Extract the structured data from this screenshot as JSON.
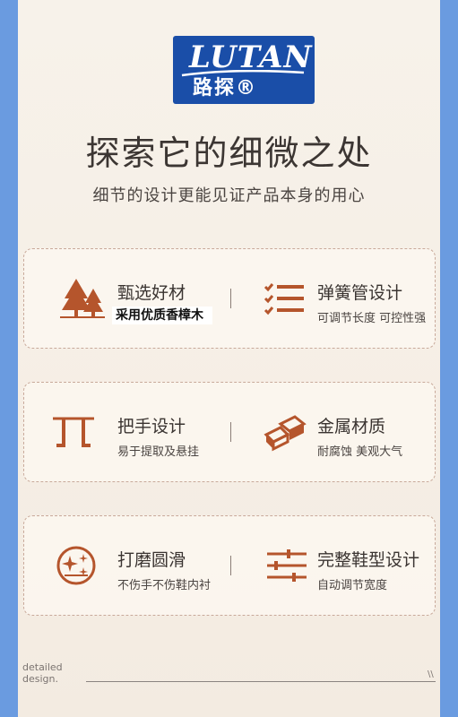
{
  "brand": {
    "logo_text": "UTAN",
    "logo_letter": "L",
    "logo_chinese": "路探®"
  },
  "header": {
    "title": "探索它的细微之处",
    "subtitle": "细节的设计更能见证产品本身的用心"
  },
  "features": [
    {
      "name": "甄选好材",
      "desc": "采用优质香樟木",
      "icon": "trees-icon"
    },
    {
      "name": "弹簧管设计",
      "desc": "可调节长度 可控性强",
      "icon": "checklist-icon"
    },
    {
      "name": "把手设计",
      "desc": "易于提取及悬挂",
      "icon": "handle-icon"
    },
    {
      "name": "金属材质",
      "desc": "耐腐蚀 美观大气",
      "icon": "metal-bars-icon"
    },
    {
      "name": "打磨圆滑",
      "desc": "不伤手不伤鞋内衬",
      "icon": "sparkle-circle-icon"
    },
    {
      "name": "完整鞋型设计",
      "desc": "自动调节宽度",
      "icon": "sliders-icon"
    }
  ],
  "footer": {
    "line1": "detailed",
    "line2": "design.",
    "mark": "\\\\"
  },
  "colors": {
    "accent": "#b5552c",
    "logo_bg": "#1a4ea8",
    "frame": "#6a9be0"
  }
}
